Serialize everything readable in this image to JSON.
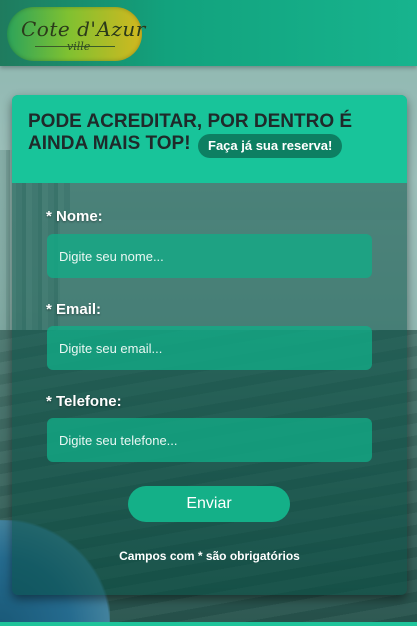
{
  "header": {
    "logo_script": "Cote d'Azur",
    "logo_sub": "ville"
  },
  "card": {
    "title": "PODE ACREDITAR, POR DENTRO É AINDA MAIS TOP!",
    "cta": "Faça já sua reserva!"
  },
  "form": {
    "name_label": "* Nome:",
    "name_placeholder": "Digite seu nome...",
    "email_label": "* Email:",
    "email_placeholder": "Digite seu email...",
    "phone_label": "* Telefone:",
    "phone_placeholder": "Digite seu telefone...",
    "submit_label": "Enviar",
    "required_note": "Campos com * são obrigatórios"
  },
  "colors": {
    "accent": "#18c49a",
    "header": "#12a27d",
    "button": "#14b088"
  }
}
